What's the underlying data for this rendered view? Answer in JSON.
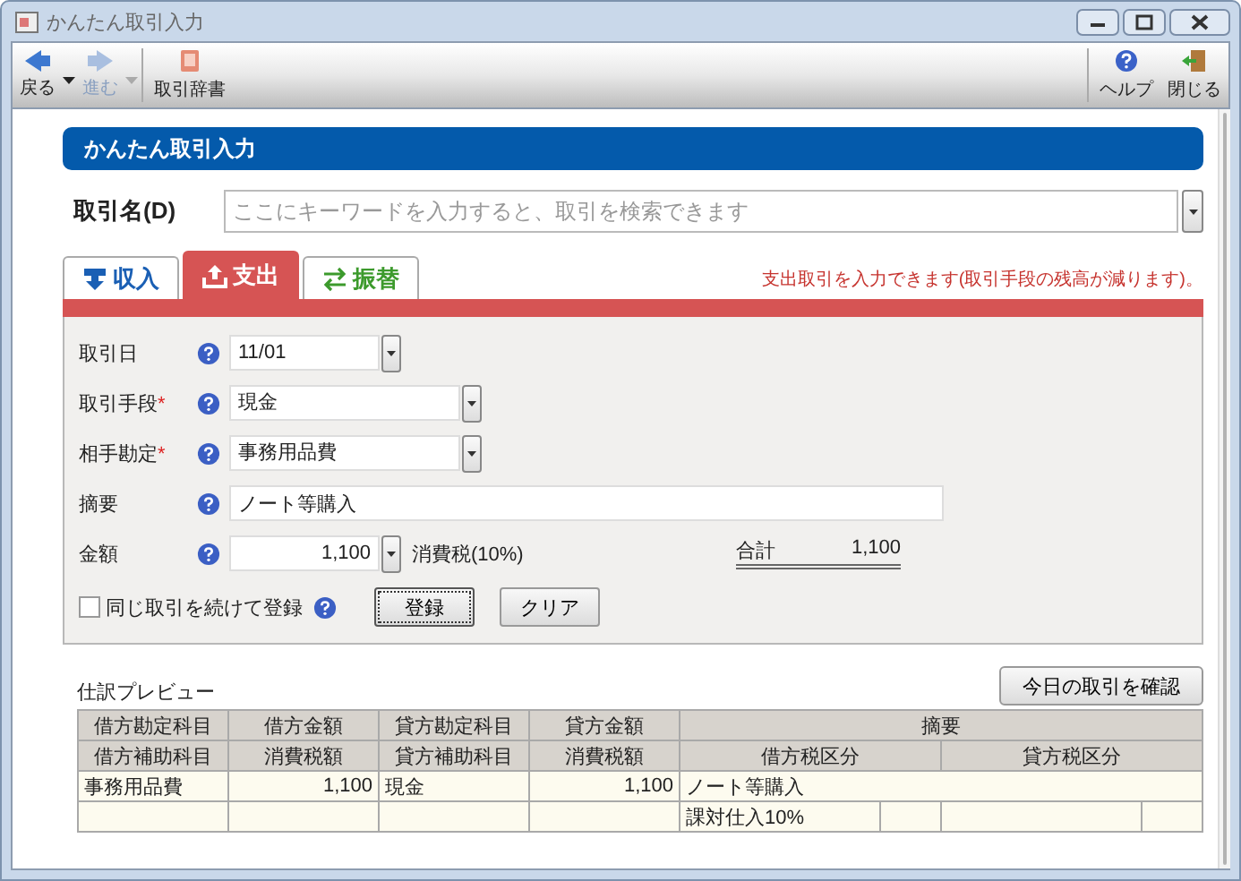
{
  "window": {
    "title": "かんたん取引入力"
  },
  "toolbar": [
    {
      "label": "戻る",
      "kind": "back",
      "disabled": false,
      "dropdown": true
    },
    {
      "label": "進む",
      "kind": "forward",
      "disabled": true,
      "dropdown": true
    },
    {
      "label": "取引辞書",
      "kind": "book",
      "disabled": false,
      "dropdown": false
    },
    {
      "label": "ヘルプ",
      "kind": "help",
      "disabled": false,
      "dropdown": false
    },
    {
      "label": "閉じる",
      "kind": "exit",
      "disabled": false,
      "dropdown": false
    }
  ],
  "header": {
    "title": "かんたん取引入力"
  },
  "transaction_name": {
    "label": "取引名(D)",
    "placeholder": "ここにキーワードを入力すると、取引を検索できます"
  },
  "tabs": [
    {
      "label": "収入",
      "kind": "income",
      "selected": false
    },
    {
      "label": "支出",
      "kind": "expense",
      "selected": true
    },
    {
      "label": "振替",
      "kind": "transfer",
      "selected": false
    }
  ],
  "tab_hint": "支出取引を入力できます(取引手段の残高が減ります)。",
  "fields": [
    {
      "label": "取引日",
      "kind": "date",
      "value": "11/01"
    },
    {
      "label": "取引手段",
      "kind": "select",
      "required_mark": "*",
      "value": "現金"
    },
    {
      "label": "相手勘定",
      "kind": "select",
      "required_mark": "*",
      "value": "事務用品費"
    },
    {
      "label": "摘要",
      "kind": "text",
      "value": "ノート等購入"
    },
    {
      "label": "金額",
      "kind": "amount",
      "value": "1,100",
      "tax_label": "消費税(10%)",
      "total_label": "合計",
      "total": "1,100"
    }
  ],
  "repeat": {
    "label": "同じ取引を続けて登録",
    "checked": false
  },
  "buttons": [
    {
      "label": "登録",
      "focused": true
    },
    {
      "label": "クリア",
      "focused": false
    }
  ],
  "preview": {
    "title": "仕訳プレビュー",
    "button": "今日の取引を確認",
    "header_rows": [
      [
        "借方勘定科目",
        "借方金額",
        "貸方勘定科目",
        "貸方金額",
        "摘要"
      ],
      [
        "借方補助科目",
        "消費税額",
        "貸方補助科目",
        "消費税額",
        "借方税区分",
        "貸方税区分"
      ]
    ],
    "rows": [
      {
        "debit_account": "事務用品費",
        "debit_amount": "1,100",
        "credit_account": "現金",
        "credit_amount": "1,100",
        "memo": "ノート等購入"
      },
      {
        "debit_tax_class": "課対仕入10%"
      }
    ]
  }
}
